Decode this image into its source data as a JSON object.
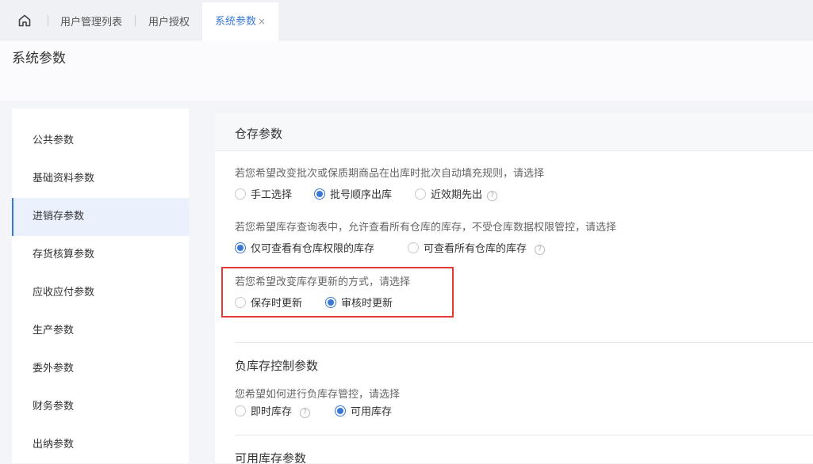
{
  "tabs": {
    "home_icon": "home-icon",
    "items": [
      "用户管理列表",
      "用户授权",
      "系统参数"
    ],
    "close_glyph": "×"
  },
  "page": {
    "title": "系统参数"
  },
  "sidebar": {
    "items": [
      "公共参数",
      "基础资料参数",
      "进销存参数",
      "存货核算参数",
      "应收应付参数",
      "生产参数",
      "委外参数",
      "财务参数",
      "出纳参数"
    ],
    "active": "进销存参数"
  },
  "warehouse": {
    "title": "仓存参数",
    "q1": {
      "question": "若您希望改变批次或保质期商品在出库时批次自动填充规则，请选择",
      "options": [
        "手工选择",
        "批号顺序出库",
        "近效期先出"
      ],
      "selected": "批号顺序出库"
    },
    "q2": {
      "question": "若您希望库存查询表中，允许查看所有仓库的库存，不受仓库数据权限管控，请选择",
      "options": [
        "仅可查看有仓库权限的库存",
        "可查看所有仓库的库存"
      ],
      "selected": "仅可查看有仓库权限的库存"
    },
    "q3": {
      "question": "若您希望改变库存更新的方式，请选择",
      "options": [
        "保存时更新",
        "审核时更新"
      ],
      "selected": "审核时更新"
    }
  },
  "negative_stock": {
    "title": "负库存控制参数",
    "question": "您希望如何进行负库存管控，请选择",
    "options": [
      "即时库存",
      "可用库存"
    ],
    "selected": "可用库存"
  },
  "available_stock": {
    "title": "可用库存参数"
  },
  "help_glyph": "?",
  "colors": {
    "accent": "#3a78d8",
    "highlight": "#e53935",
    "active_bg": "#eaf1fd"
  }
}
